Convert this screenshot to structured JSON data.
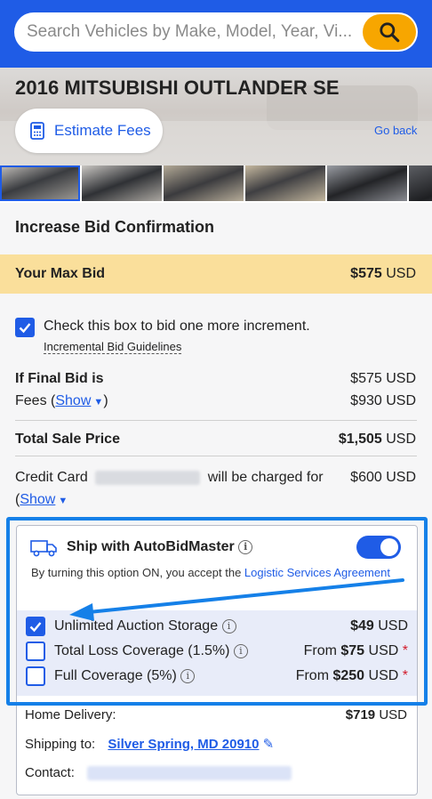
{
  "search": {
    "placeholder": "Search Vehicles by Make, Model, Year, Vi..."
  },
  "vehicle": {
    "title": "2016 MITSUBISHI OUTLANDER SE"
  },
  "actions": {
    "estimate_fees": "Estimate Fees",
    "go_back": "Go back"
  },
  "confirmation": {
    "title": "Increase Bid Confirmation",
    "max_bid_label": "Your Max Bid",
    "max_bid_amount": "$575",
    "max_bid_currency": "USD",
    "increment_text": "Check this box to bid one more increment.",
    "increment_guidelines": "Incremental Bid Guidelines",
    "final_bid_label": "If Final Bid is",
    "final_bid_value": "$575 USD",
    "fees_label": "Fees (",
    "fees_show": "Show",
    "fees_close": ")",
    "fees_value": "$930 USD",
    "total_label": "Total Sale Price",
    "total_amount": "$1,505",
    "total_currency": "USD",
    "credit_card_prefix": "Credit Card",
    "credit_card_suffix": "will be charged for",
    "credit_card_amount": "$600 USD",
    "credit_show_open": "(",
    "credit_show": "Show"
  },
  "shipping": {
    "title": "Ship with AutoBidMaster",
    "toggle_on": true,
    "desc_prefix": "By turning this option ON, you accept the ",
    "desc_link": "Logistic Services Agreement",
    "options": [
      {
        "label": "Unlimited Auction Storage",
        "price_prefix": "",
        "price": "$49",
        "currency": "USD",
        "checked": true,
        "asterisk": ""
      },
      {
        "label": "Total Loss Coverage (1.5%)",
        "price_prefix": "From ",
        "price": "$75",
        "currency": "USD",
        "checked": false,
        "asterisk": "*"
      },
      {
        "label": "Full Coverage (5%)",
        "price_prefix": "From ",
        "price": "$250",
        "currency": "USD",
        "checked": false,
        "asterisk": "*"
      }
    ],
    "home_delivery_label": "Home Delivery:",
    "home_delivery_price": "$719",
    "home_delivery_currency": "USD",
    "shipping_to_label": "Shipping to:",
    "shipping_to_value": "Silver Spring, MD 20910",
    "contact_label": "Contact:"
  },
  "colors": {
    "brand_blue": "#1f5ce6",
    "accent_orange": "#f7a600",
    "highlight_yellow": "#fadf9b",
    "annotation_blue": "#1580e8"
  }
}
